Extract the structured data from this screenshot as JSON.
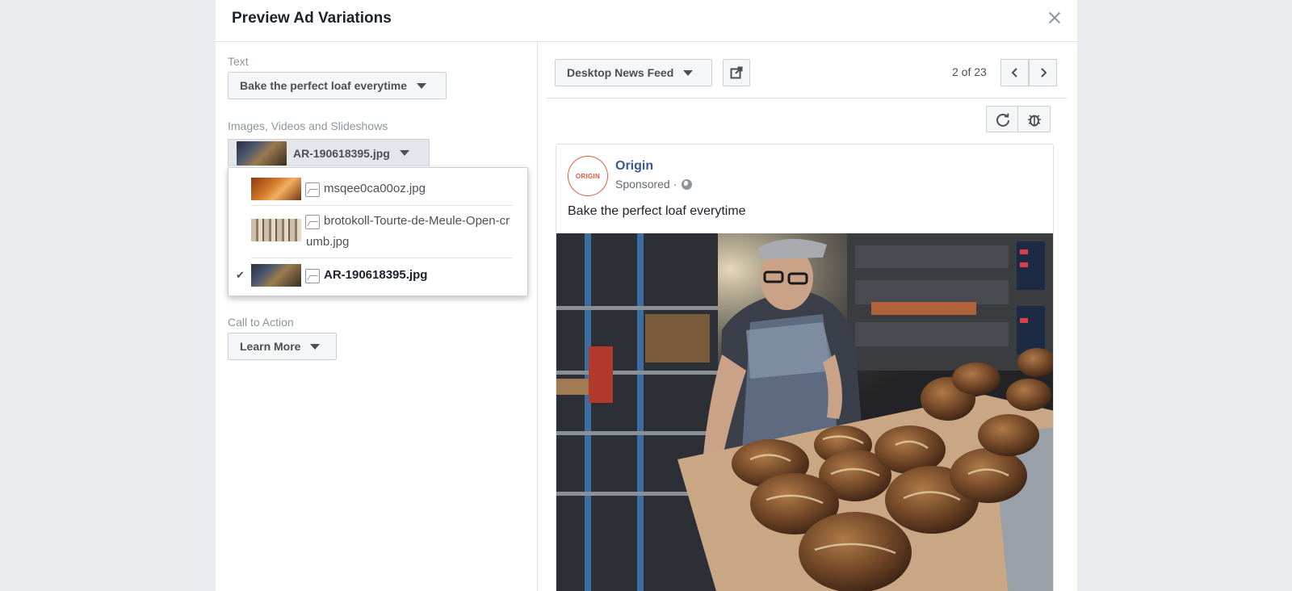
{
  "modal": {
    "title": "Preview Ad Variations"
  },
  "left": {
    "text_label": "Text",
    "text_value": "Bake the perfect loaf everytime",
    "media_label": "Images, Videos and Slideshows",
    "media_value": "AR-190618395.jpg",
    "media_options": [
      {
        "name": "msqee0ca00oz.jpg",
        "selected": false
      },
      {
        "name": "brotokoll-Tourte-de-Meule-Open-crumb.jpg",
        "selected": false
      },
      {
        "name": "AR-190618395.jpg",
        "selected": true
      }
    ],
    "check_glyph": "✔",
    "cta_label": "Call to Action",
    "cta_value": "Learn More"
  },
  "right": {
    "placement": "Desktop News Feed",
    "pager": "2 of 23",
    "post": {
      "page_name": "Origin",
      "avatar_text": "ORIGIN",
      "sponsored": "Sponsored ·",
      "body": "Bake the perfect loaf everytime"
    }
  },
  "colors": {
    "link": "#385898",
    "brand_orange": "#e2593d",
    "backdrop": "#e9ebee"
  }
}
